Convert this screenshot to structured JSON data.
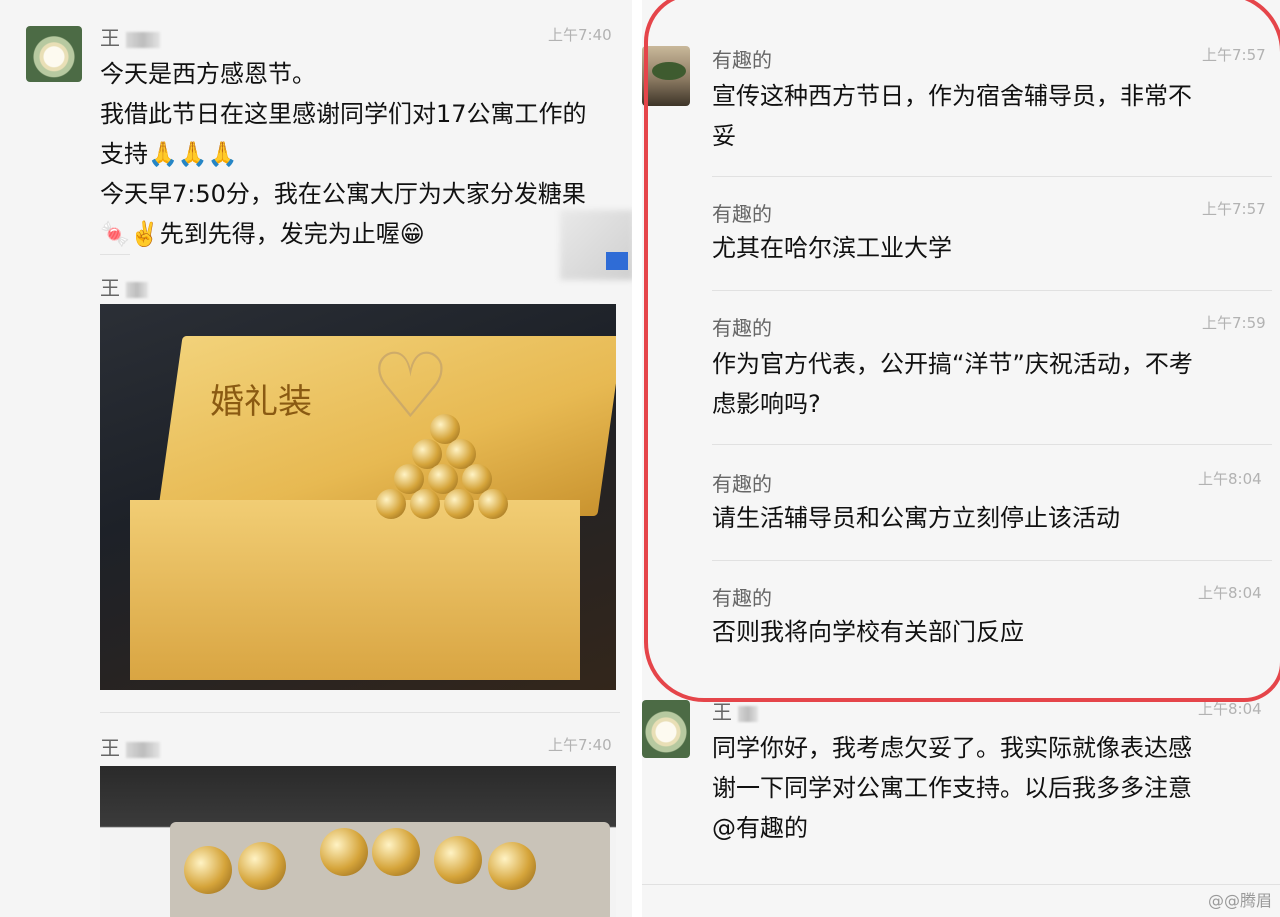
{
  "left": {
    "messages": [
      {
        "name": "王",
        "time": "上午7:40",
        "lines": [
          "今天是西方感恩节。",
          "我借此节日在这里感谢同学们对17公寓工作的",
          "支持🙏🙏🙏",
          "今天早7:50分，我在公寓大厅为大家分发糖果",
          "🍬✌️先到先得，发完为止喔😁"
        ]
      },
      {
        "name": "王"
      },
      {
        "name": "王",
        "time": "上午7:40"
      }
    ],
    "photo1": {
      "brand": "婚礼装"
    }
  },
  "right": {
    "messages": [
      {
        "name": "有趣的",
        "time": "上午7:57",
        "lines": [
          "宣传这种西方节日，作为宿舍辅导员，非常不",
          "妥"
        ]
      },
      {
        "name": "有趣的",
        "time": "上午7:57",
        "lines": [
          "尤其在哈尔滨工业大学"
        ]
      },
      {
        "name": "有趣的",
        "time": "上午7:59",
        "lines": [
          "作为官方代表，公开搞“洋节”庆祝活动，不考",
          "虑影响吗?"
        ]
      },
      {
        "name": "有趣的",
        "time": "上午8:04",
        "lines": [
          "请生活辅导员和公寓方立刻停止该活动"
        ]
      },
      {
        "name": "有趣的",
        "time": "上午8:04",
        "lines": [
          "否则我将向学校有关部门反应"
        ]
      },
      {
        "name": "王",
        "time": "上午8:04",
        "lines": [
          "同学你好，我考虑欠妥了。我实际就像表达感",
          "谢一下同学对公寓工作支持。以后我多多注意",
          "@有趣的"
        ]
      }
    ],
    "watermark": "@@腾眉"
  },
  "colors": {
    "highlight_circle": "#e5454a",
    "time_text": "#b2b2b2"
  }
}
